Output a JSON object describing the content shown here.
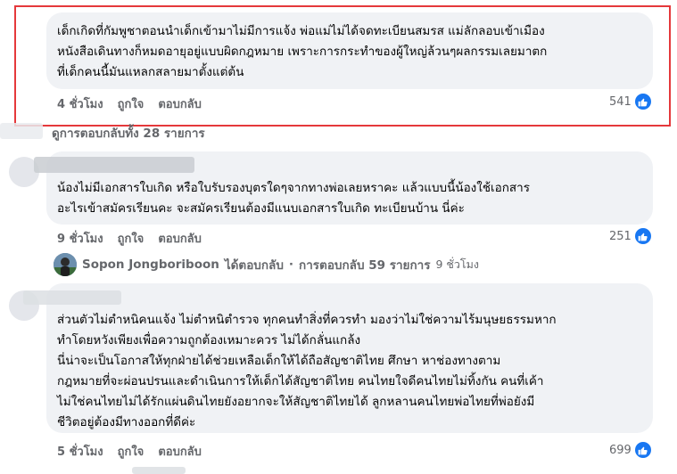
{
  "comment1": {
    "text": "เด็กเกิดที่กัมพูชาตอนนำเด็กเข้ามาไม่มีการแจ้ง พ่อแม่ไม่ได้จดทะเบียนสมรส แม่ลักลอบเข้าเมือง\nหนังสือเดินทางก็หมดอายุอยู่แบบผิดกฎหมาย เพราะการกระทำของผู้ใหญ่ล้วนๆผลกรรมเลยมาตก\nที่เด็กคนนี้มันแหลกสลายมาตั้งแต่ต้น",
    "time": "4 ชั่วโมง",
    "like": "ถูกใจ",
    "reply": "ตอบกลับ",
    "reactions": "541"
  },
  "view_replies": "ดูการตอบกลับทั้ง 28 รายการ",
  "comment2": {
    "text": "น้องไม่มีเอกสารใบเกิด หรือใบรับรองบุตรใดๆจากทางพ่อเลยหราคะ แล้วแบบนี้น้องใช้เอกสาร\nอะไรเข้าสมัครเรียนคะ จะสมัครเรียนต้องมีแนบเอกสารใบเกิด ทะเบียนบ้าน นี่ค่ะ",
    "time": "9 ชั่วโมง",
    "like": "ถูกใจ",
    "reply": "ตอบกลับ",
    "reactions": "251"
  },
  "reply_summary": {
    "name": "Sopon Jongboriboon",
    "action": "ได้ตอบกลับ",
    "dot": "·",
    "count": "การตอบกลับ 59 รายการ",
    "time": "9 ชั่วโมง"
  },
  "comment3": {
    "text": "ส่วนตัวไม่ตำหนิคนแจ้ง ไม่ตำหนิตำรวจ ทุกคนทำสิ่งที่ควรทำ มองว่าไม่ใช่ความไร้มนุษยธรรมหาก\nทำโดยหวังเพียงเพื่อความถูกต้องเหมาะควร ไม่ได้กลั่นแกล้ง\nนี่น่าจะเป็นโอกาสให้ทุกฝ่ายได้ช่วยเหลือเด็กให้ได้ถือสัญชาติไทย ศึกษา หาช่องทางตาม\nกฎหมายที่จะผ่อนปรนและดำเนินการให้เด็กได้สัญชาติไทย คนไทยใจดีคนไทยไม่ทิ้งกัน คนที่เค้า\nไม่ใช่คนไทยไม่ได้รักแผ่นดินไทยยังอยากจะให้สัญชาติไทยได้ ลูกหลานคนไทยพ่อไทยที่พ่อยังมี\nชีวิตอยู่ต้องมีทางออกที่ดีค่ะ",
    "time": "5 ชั่วโมง",
    "like": "ถูกใจ",
    "reply": "ตอบกลับ",
    "reactions": "699"
  },
  "colors": {
    "like_blue": "#1877f2",
    "highlight_red": "#e5383b",
    "bubble": "#f0f2f5"
  }
}
